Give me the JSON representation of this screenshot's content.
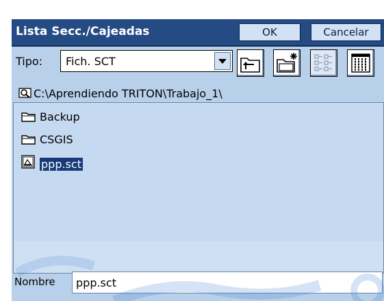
{
  "dialog": {
    "title": "Lista Secc./Cajeadas",
    "ok_label": "OK",
    "cancel_label": "Cancelar"
  },
  "filter": {
    "label": "Tipo:",
    "selected": "Fich. SCT"
  },
  "toolbar": {
    "up_icon": "folder-up-icon",
    "new_folder_icon": "new-folder-icon",
    "list_view_icon": "list-view-icon",
    "details_view_icon": "details-view-icon"
  },
  "path": {
    "icon": "drive-search-icon",
    "text": "C:\\Aprendiendo TRITON\\Trabajo_1\\"
  },
  "files": [
    {
      "name": "Backup",
      "type": "folder"
    },
    {
      "name": "CSGIS",
      "type": "folder"
    },
    {
      "name": "ppp.sct",
      "type": "file",
      "selected": true
    }
  ],
  "name_field": {
    "label": "Nombre",
    "value": "ppp.sct"
  },
  "colors": {
    "titlebar": "#244b84",
    "dialog_bg": "#b9d0ea",
    "list_bg": "#c5d9f0",
    "selection": "#173a78"
  }
}
